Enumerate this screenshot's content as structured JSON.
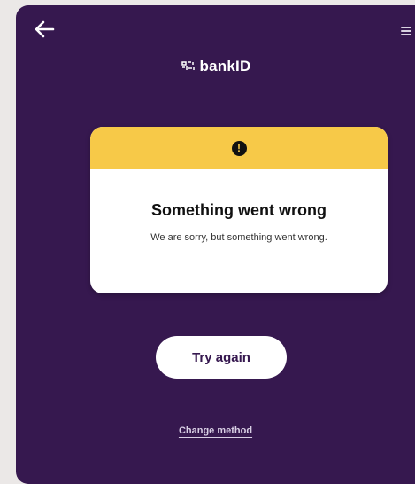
{
  "header": {
    "back_icon": "arrow-left-icon",
    "menu_icon": "hamburger-menu-icon",
    "brand_name": "bankID",
    "brand_icon": "bankid-logo-icon"
  },
  "error_card": {
    "icon": "exclamation-circle-icon",
    "icon_glyph": "!",
    "title": "Something went wrong",
    "message": "We are sorry, but something went wrong."
  },
  "actions": {
    "try_again_label": "Try again",
    "change_method_label": "Change method"
  },
  "colors": {
    "background": "#36184f",
    "warning_accent": "#f7c948",
    "card": "#ffffff"
  }
}
